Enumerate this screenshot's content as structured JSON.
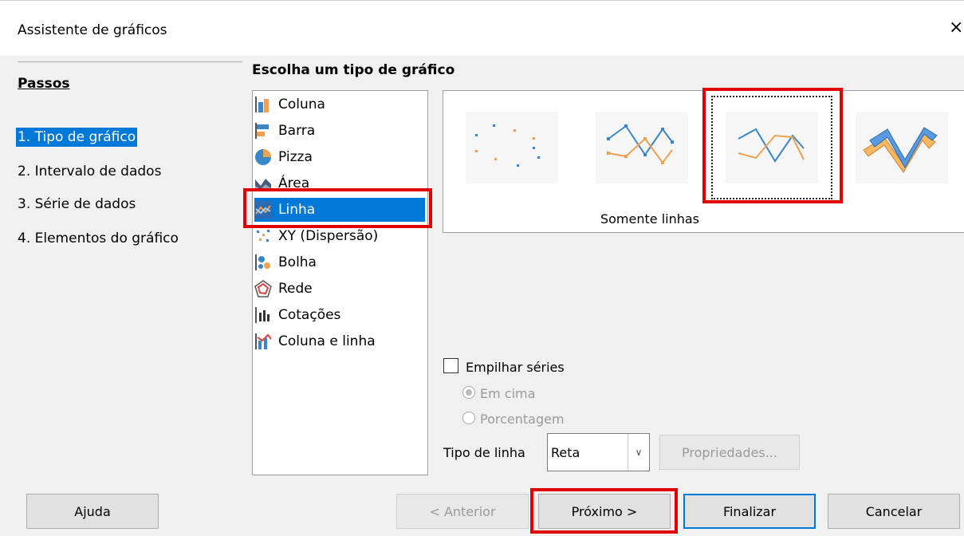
{
  "window": {
    "title": "Assistente de gráficos",
    "close_glyph": "×"
  },
  "steps": {
    "title": "Passos",
    "items": [
      {
        "label": "1. Tipo de gráfico",
        "active": true
      },
      {
        "label": "2. Intervalo de dados",
        "active": false
      },
      {
        "label": "3. Série de dados",
        "active": false
      },
      {
        "label": "4. Elementos do gráfico",
        "active": false
      }
    ]
  },
  "chart_types": {
    "heading": "Escolha um tipo de gráfico",
    "selected": "Linha",
    "items": [
      {
        "label": "Coluna",
        "icon": "column-chart-icon"
      },
      {
        "label": "Barra",
        "icon": "bar-chart-icon"
      },
      {
        "label": "Pizza",
        "icon": "pie-chart-icon"
      },
      {
        "label": "Área",
        "icon": "area-chart-icon"
      },
      {
        "label": "Linha",
        "icon": "line-chart-icon"
      },
      {
        "label": "XY (Dispersão)",
        "icon": "scatter-chart-icon"
      },
      {
        "label": "Bolha",
        "icon": "bubble-chart-icon"
      },
      {
        "label": "Rede",
        "icon": "net-chart-icon"
      },
      {
        "label": "Cotações",
        "icon": "stock-chart-icon"
      },
      {
        "label": "Coluna e linha",
        "icon": "column-line-chart-icon"
      }
    ]
  },
  "variants": {
    "selected_label": "Somente linhas",
    "items": [
      {
        "name": "points-only",
        "icon": "points-only-icon"
      },
      {
        "name": "points-and-lines",
        "icon": "points-and-lines-icon"
      },
      {
        "name": "lines-only",
        "icon": "lines-only-icon"
      },
      {
        "name": "3d-lines",
        "icon": "3d-lines-icon"
      }
    ]
  },
  "options": {
    "stack_label": "Empilhar séries",
    "stack_checked": false,
    "on_top_label": "Em cima",
    "percent_label": "Porcentagem",
    "line_type_label": "Tipo de linha",
    "line_type_value": "Reta",
    "properties_label": "Propriedades..."
  },
  "buttons": {
    "help": "Ajuda",
    "previous": "< Anterior",
    "next": "Próximo >",
    "finish": "Finalizar",
    "cancel": "Cancelar"
  },
  "colors": {
    "selection": "#0078d7",
    "highlight_red": "#e00000",
    "series_blue": "#3a86c8",
    "series_orange": "#f0a050"
  }
}
